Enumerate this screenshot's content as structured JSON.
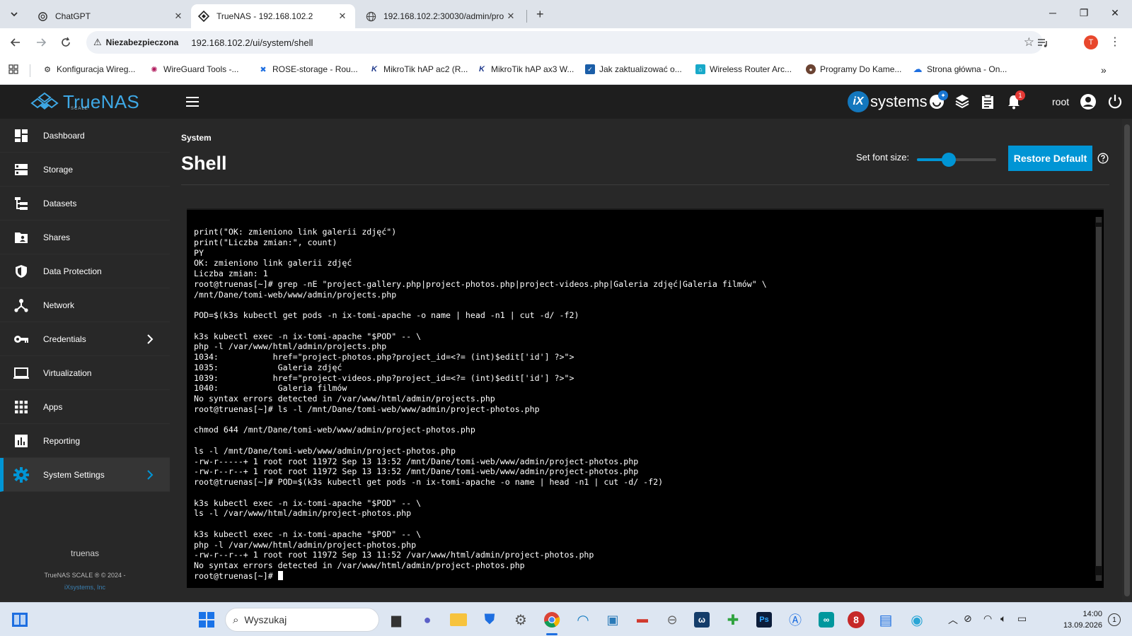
{
  "browser": {
    "tabs": [
      {
        "title": "ChatGPT",
        "icon": "chatgpt-icon",
        "active": false
      },
      {
        "title": "TrueNAS - 192.168.102.2",
        "icon": "truenas-icon",
        "active": true
      },
      {
        "title": "192.168.102.2:30030/admin/pro",
        "icon": "globe-icon",
        "active": false
      }
    ],
    "security_label": "Niezabezpieczona",
    "url": "192.168.102.2/ui/system/shell",
    "profile_initial": "T",
    "bookmarks": [
      {
        "label": "Konfiguracja Wireg...",
        "icon": "gear-icon"
      },
      {
        "label": "WireGuard Tools -...",
        "icon": "wireguard-icon"
      },
      {
        "label": "ROSE-storage - Rou...",
        "icon": "rose-icon"
      },
      {
        "label": "MikroTik hAP ac2 (R...",
        "icon": "mikrotik-icon"
      },
      {
        "label": "MikroTik hAP ax3 W...",
        "icon": "mikrotik-icon"
      },
      {
        "label": "Jak zaktualizować o...",
        "icon": "doc-icon"
      },
      {
        "label": "Wireless Router Arc...",
        "icon": "router-icon"
      },
      {
        "label": "Programy Do Kame...",
        "icon": "camera-icon"
      },
      {
        "label": "Strona główna - On...",
        "icon": "cloud-icon"
      }
    ]
  },
  "app": {
    "logo_text": "TrueNAS",
    "logo_sub": "SCALE",
    "vendor": "systems",
    "vendor_mark": "iX",
    "user": "root",
    "alert_count": "1",
    "nav": [
      {
        "label": "Dashboard",
        "icon": "dashboard-icon",
        "chevron": false,
        "active": false
      },
      {
        "label": "Storage",
        "icon": "storage-icon",
        "chevron": false,
        "active": false
      },
      {
        "label": "Datasets",
        "icon": "datasets-icon",
        "chevron": false,
        "active": false
      },
      {
        "label": "Shares",
        "icon": "shares-icon",
        "chevron": false,
        "active": false
      },
      {
        "label": "Data Protection",
        "icon": "shield-icon",
        "chevron": false,
        "active": false
      },
      {
        "label": "Network",
        "icon": "network-icon",
        "chevron": false,
        "active": false
      },
      {
        "label": "Credentials",
        "icon": "key-icon",
        "chevron": true,
        "active": false
      },
      {
        "label": "Virtualization",
        "icon": "monitor-icon",
        "chevron": false,
        "active": false
      },
      {
        "label": "Apps",
        "icon": "apps-grid-icon",
        "chevron": false,
        "active": false
      },
      {
        "label": "Reporting",
        "icon": "reporting-icon",
        "chevron": false,
        "active": false
      },
      {
        "label": "System Settings",
        "icon": "gear-icon",
        "chevron": true,
        "active": true
      }
    ],
    "hostname": "truenas",
    "copyright": "TrueNAS SCALE ® © 2024 -",
    "company": "iXsystems, Inc"
  },
  "page": {
    "breadcrumb": "System",
    "title": "Shell",
    "font_size_label": "Set font size:",
    "font_size_fraction": 0.4,
    "restore_label": "Restore Default"
  },
  "terminal": {
    "lines": [
      "print(\"OK: zmieniono link galerii zdjęć\")",
      "print(\"Liczba zmian:\", count)",
      "PY",
      "OK: zmieniono link galerii zdjęć",
      "Liczba zmian: 1",
      "root@truenas[~]# grep -nE \"project-gallery.php|project-photos.php|project-videos.php|Galeria zdjęć|Galeria filmów\" \\",
      "/mnt/Dane/tomi-web/www/admin/projects.php",
      "",
      "POD=$(k3s kubectl get pods -n ix-tomi-apache -o name | head -n1 | cut -d/ -f2)",
      "",
      "k3s kubectl exec -n ix-tomi-apache \"$POD\" -- \\",
      "php -l /var/www/html/admin/projects.php",
      "1034:           href=\"project-photos.php?project_id=<?= (int)$edit['id'] ?>\">",
      "1035:            Galeria zdjęć",
      "1039:           href=\"project-videos.php?project_id=<?= (int)$edit['id'] ?>\">",
      "1040:            Galeria filmów",
      "No syntax errors detected in /var/www/html/admin/projects.php",
      "root@truenas[~]# ls -l /mnt/Dane/tomi-web/www/admin/project-photos.php",
      "",
      "chmod 644 /mnt/Dane/tomi-web/www/admin/project-photos.php",
      "",
      "ls -l /mnt/Dane/tomi-web/www/admin/project-photos.php",
      "-rw-r-----+ 1 root root 11972 Sep 13 13:52 /mnt/Dane/tomi-web/www/admin/project-photos.php",
      "-rw-r--r--+ 1 root root 11972 Sep 13 13:52 /mnt/Dane/tomi-web/www/admin/project-photos.php",
      "root@truenas[~]# POD=$(k3s kubectl get pods -n ix-tomi-apache -o name | head -n1 | cut -d/ -f2)",
      "",
      "k3s kubectl exec -n ix-tomi-apache \"$POD\" -- \\",
      "ls -l /var/www/html/admin/project-photos.php",
      "",
      "k3s kubectl exec -n ix-tomi-apache \"$POD\" -- \\",
      "php -l /var/www/html/admin/project-photos.php",
      "-rw-r--r--+ 1 root root 11972 Sep 13 11:52 /var/www/html/admin/project-photos.php",
      "No syntax errors detected in /var/www/html/admin/project-photos.php"
    ],
    "prompt": "root@truenas[~]# "
  },
  "taskbar": {
    "search_placeholder": "Wyszukaj",
    "time": "14:00",
    "date": "13.09.2026",
    "notification_count": "1"
  }
}
